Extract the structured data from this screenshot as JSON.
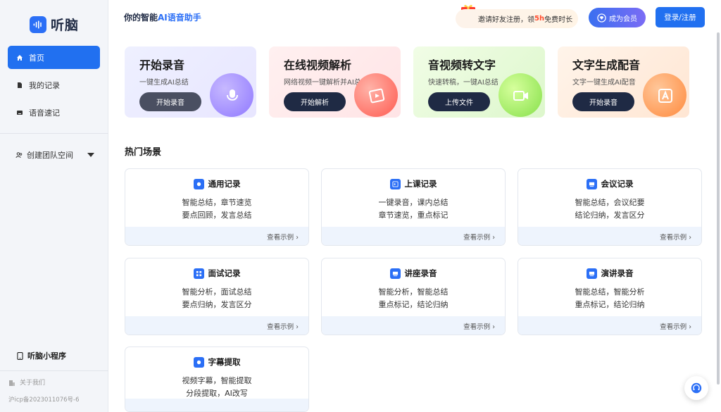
{
  "brand": {
    "name": "听脑",
    "accent": "#2170f0"
  },
  "sidebar": {
    "items": [
      {
        "label": "首页",
        "icon": "home-icon",
        "active": true
      },
      {
        "label": "我的记录",
        "icon": "document-icon",
        "active": false
      },
      {
        "label": "语音速记",
        "icon": "keyboard-icon",
        "active": false
      }
    ],
    "team_label": "创建团队空间",
    "mini_program": "听脑小程序",
    "about": "关于我们",
    "icp": "沪icp备2023011076号-6"
  },
  "header": {
    "slogan_pre": "你的智能",
    "slogan_hl": "AI语音助手",
    "invite_pre": "邀请好友注册，领",
    "invite_hl": "5h",
    "invite_post": "免费时长",
    "vip": "成为会员",
    "login": "登录/注册"
  },
  "features": [
    {
      "title": "开始录音",
      "desc": "一键生成AI总结",
      "button": "开始录音",
      "icon": "microphone-icon"
    },
    {
      "title": "在线视频解析",
      "desc": "网络视频一键解析并AI总结",
      "button": "开始解析",
      "icon": "video-play-icon"
    },
    {
      "title": "音视频转文字",
      "desc": "快速转稿，一键AI总结",
      "button": "上传文件",
      "icon": "camera-icon"
    },
    {
      "title": "文字生成配音",
      "desc": "文字一键生成AI配音",
      "button": "开始录音",
      "icon": "text-a-icon"
    }
  ],
  "scenes_title": "热门场景",
  "view_example": "查看示例 ›",
  "scenes": [
    {
      "title": "通用记录",
      "l1": "智能总结，章节速览",
      "l2": "要点回顾，发言总结"
    },
    {
      "title": "上课记录",
      "l1": "一键录音，课内总结",
      "l2": "章节速览，重点标记"
    },
    {
      "title": "会议记录",
      "l1": "智能总结，会议纪要",
      "l2": "结论归纳，发言区分"
    },
    {
      "title": "面试记录",
      "l1": "智能分析，面试总结",
      "l2": "要点归纳，发言区分"
    },
    {
      "title": "讲座录音",
      "l1": "智能分析，智能总结",
      "l2": "重点标记，结论归纳"
    },
    {
      "title": "演讲录音",
      "l1": "智能总结，智能分析",
      "l2": "重点标记，结论归纳"
    },
    {
      "title": "字幕提取",
      "l1": "视频字幕，智能提取",
      "l2": "分段提取，AI改写"
    }
  ]
}
